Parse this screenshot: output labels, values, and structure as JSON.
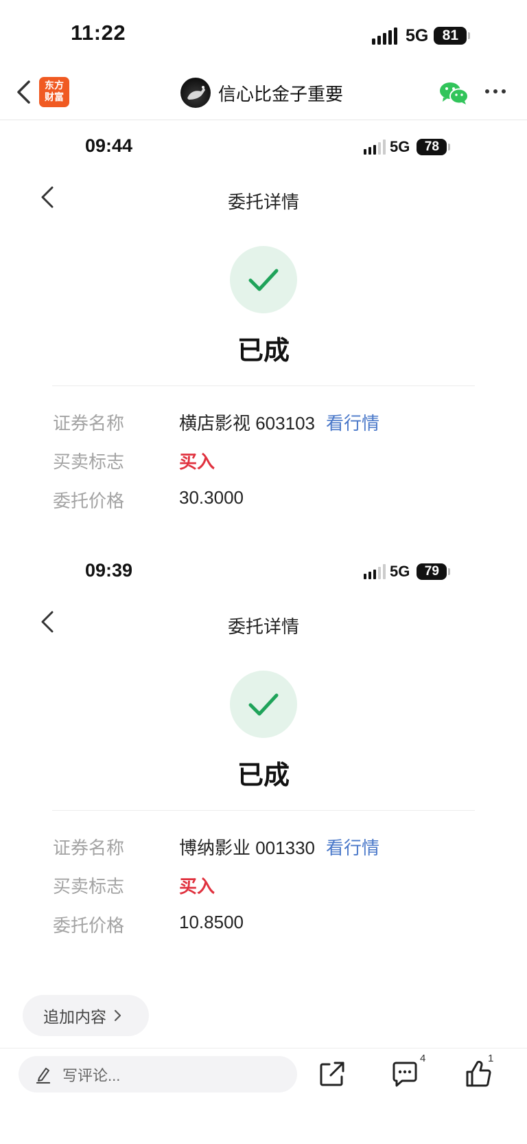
{
  "status_bar": {
    "time": "11:22",
    "network": "5G",
    "battery": "81"
  },
  "nav": {
    "logo_line1": "东方",
    "logo_line2": "财富",
    "title": "信心比金子重要"
  },
  "screens": [
    {
      "time": "09:44",
      "network": "5G",
      "battery": "78",
      "title": "委托详情",
      "status": "已成",
      "rows": [
        {
          "label": "证券名称",
          "value": "横店影视 603103",
          "link": "看行情"
        },
        {
          "label": "买卖标志",
          "value": "买入"
        },
        {
          "label": "委托价格",
          "value": "30.3000"
        }
      ]
    },
    {
      "time": "09:39",
      "network": "5G",
      "battery": "79",
      "title": "委托详情",
      "status": "已成",
      "rows": [
        {
          "label": "证券名称",
          "value": "博纳影业 001330",
          "link": "看行情"
        },
        {
          "label": "买卖标志",
          "value": "买入"
        },
        {
          "label": "委托价格",
          "value": "10.8500"
        }
      ]
    }
  ],
  "bottom": {
    "add_more": "追加内容",
    "comment_placeholder": "写评论...",
    "comment_count": "4",
    "like_count": "1"
  },
  "colors": {
    "buy": "#e0323f",
    "link": "#4a78c9",
    "check": "#1fa35a",
    "logo": "#f05a22",
    "wechat": "#31c45a"
  }
}
